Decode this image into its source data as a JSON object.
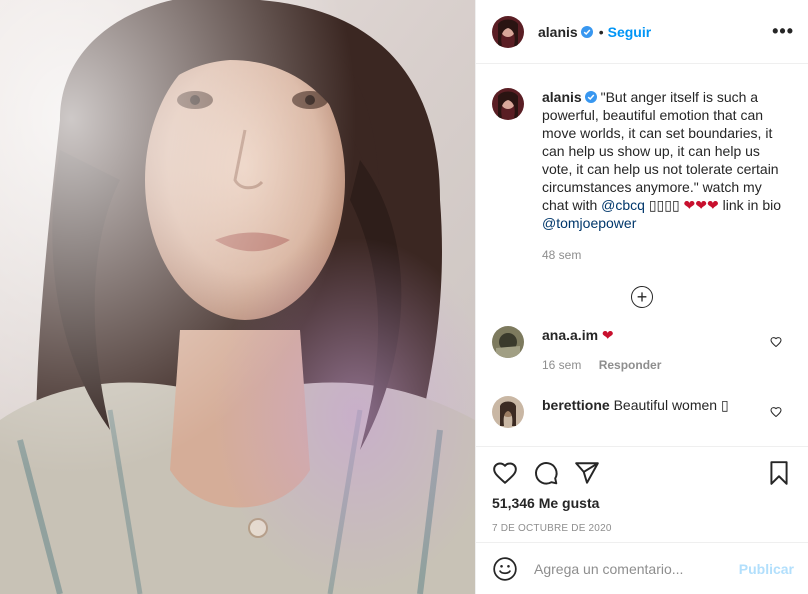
{
  "header": {
    "username": "alanis",
    "dot": "•",
    "follow_label": "Seguir",
    "more_label": "•••"
  },
  "caption": {
    "username": "alanis",
    "text_main": "\"But anger itself is such a powerful, beautiful emotion that can move worlds, it can set boundaries, it can help us show up, it can help us vote, it can help us not tolerate certain circumstances anymore.\" watch my chat with ",
    "mention_1": "@cbcq",
    "boxes": "▯▯▯▯",
    "hearts": "❤❤❤",
    "text_after": " link in bio ",
    "mention_2": "@tomjoepower",
    "time": "48 sem"
  },
  "load_more_icon": "plus-circle-icon",
  "comments": [
    {
      "username": "ana.a.im",
      "text": "❤",
      "time": "16 sem",
      "reply": "Responder"
    },
    {
      "username": "berettione",
      "text": "Beautiful women ▯"
    }
  ],
  "actions": {
    "likes": "51,346 Me gusta",
    "date": "7 DE OCTUBRE DE 2020"
  },
  "add_comment": {
    "placeholder": "Agrega un comentario...",
    "publish": "Publicar"
  },
  "colors": {
    "accent": "#0095f6",
    "link": "#00376b",
    "muted": "#8e8e8e",
    "publish_disabled": "#b2dffc",
    "verified": "#3897f0"
  }
}
